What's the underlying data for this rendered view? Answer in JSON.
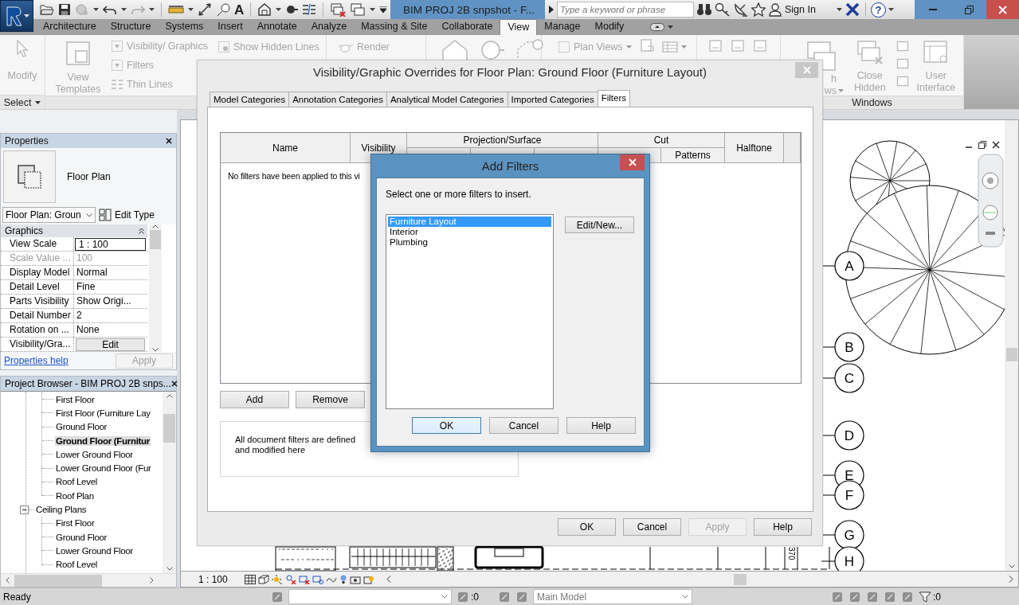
{
  "title_bar": {
    "text_tool_glyph": "A",
    "title": "BIM PROJ 2B snpshot - F...",
    "search": {
      "placeholder": "Type a keyword or phrase"
    },
    "sign_in": "Sign In",
    "help_glyph": "?"
  },
  "ribbon_tabs": [
    {
      "label": "Architecture",
      "selected": false
    },
    {
      "label": "Structure",
      "selected": false
    },
    {
      "label": "Systems",
      "selected": false
    },
    {
      "label": "Insert",
      "selected": false
    },
    {
      "label": "Annotate",
      "selected": false
    },
    {
      "label": "Analyze",
      "selected": false
    },
    {
      "label": "Massing & Site",
      "selected": false
    },
    {
      "label": "Collaborate",
      "selected": false
    },
    {
      "label": "View",
      "selected": true
    },
    {
      "label": "Manage",
      "selected": false
    },
    {
      "label": "Modify",
      "selected": false
    }
  ],
  "ribbon": {
    "modify": "Modify",
    "select_panel": "Select",
    "view_templates": "View Templates",
    "graphics_buttons": [
      "Visibility/ Graphics",
      "Filters",
      "Thin Lines"
    ],
    "show_hidden_lines": "Show Hidden Lines",
    "render": "Render",
    "plan_views": "Plan Views",
    "switch_windows_visible": "h ws",
    "close_hidden": "Close Hidden",
    "user_interface": "User Interface",
    "windows_panel": "Windows"
  },
  "properties": {
    "title": "Properties",
    "type_name": "Floor Plan",
    "type_selector": "Floor Plan: Groun",
    "edit_type": "Edit Type",
    "group": "Graphics",
    "rows": [
      {
        "name": "View Scale",
        "value": "1 : 100",
        "kind": "field",
        "disabled": false
      },
      {
        "name": "Scale Value ...",
        "value": "100",
        "kind": "text",
        "disabled": true
      },
      {
        "name": "Display Model",
        "value": "Normal",
        "kind": "text",
        "disabled": false
      },
      {
        "name": "Detail Level",
        "value": "Fine",
        "kind": "text",
        "disabled": false
      },
      {
        "name": "Parts Visibility",
        "value": "Show Origi...",
        "kind": "text",
        "disabled": false
      },
      {
        "name": "Detail Number",
        "value": "2",
        "kind": "text",
        "disabled": false
      },
      {
        "name": "Rotation on ...",
        "value": "None",
        "kind": "text",
        "disabled": false
      },
      {
        "name": "Visibility/Gra...",
        "value": "Edit",
        "kind": "button",
        "disabled": false
      }
    ],
    "help_link": "Properties help",
    "apply": {
      "label": "Apply",
      "disabled": true
    }
  },
  "project_browser": {
    "title": "Project Browser - BIM PROJ 2B snps...",
    "tree": [
      {
        "children": [
          {
            "label": "First Floor",
            "selected": false
          },
          {
            "label": "First Floor (Furniture Lay",
            "selected": false
          },
          {
            "label": "Ground  Floor",
            "selected": false
          },
          {
            "label": "Ground  Floor  (Furnitur",
            "selected": true
          },
          {
            "label": "Lower Ground Floor",
            "selected": false
          },
          {
            "label": "Lower Ground Floor (Fur",
            "selected": false
          },
          {
            "label": "Roof Level",
            "selected": false
          },
          {
            "label": "Roof Plan",
            "selected": false
          }
        ]
      },
      {
        "label": "Ceiling Plans",
        "selected": false,
        "expanded": true,
        "children": [
          {
            "label": "First Floor",
            "selected": false
          },
          {
            "label": "Ground  Floor",
            "selected": false
          },
          {
            "label": "Lower Ground Floor",
            "selected": false
          },
          {
            "label": "Roof Level",
            "selected": false
          }
        ]
      }
    ]
  },
  "canvas": {
    "grid_bubbles": [
      "A",
      "B",
      "C",
      "D",
      "E",
      "F",
      "G",
      "H"
    ],
    "dimension_text": "370"
  },
  "view_bar": {
    "scale": "1 : 100"
  },
  "status_bar": {
    "message": "Ready",
    "workset_count": ":0",
    "model": "Main Model",
    "filter_count": ":0"
  },
  "vg_dialog": {
    "title": "Visibility/Graphic Overrides for Floor Plan: Ground  Floor  (Furniture  Layout)",
    "tabs": [
      {
        "label": "Model Categories",
        "selected": false
      },
      {
        "label": "Annotation Categories",
        "selected": false
      },
      {
        "label": "Analytical Model Categories",
        "selected": false
      },
      {
        "label": "Imported Categories",
        "selected": false
      },
      {
        "label": "Filters",
        "selected": true
      }
    ],
    "columns": [
      {
        "label": "Name"
      },
      {
        "label": "Visibility"
      },
      {
        "label": "Projection/Surface"
      },
      {
        "label": "Cut",
        "subcolumn": "Patterns"
      },
      {
        "label": "Halftone"
      }
    ],
    "empty_message": "No filters have been applied to this vi",
    "add": "Add",
    "remove": "Remove",
    "note": "All document filters are defined and modified here",
    "buttons": [
      {
        "label": "OK",
        "disabled": false
      },
      {
        "label": "Cancel",
        "disabled": false
      },
      {
        "label": "Apply",
        "disabled": true
      },
      {
        "label": "Help",
        "disabled": false
      }
    ]
  },
  "add_filters": {
    "title": "Add Filters",
    "prompt": "Select one or more filters to insert.",
    "filters": [
      {
        "label": "Furniture Layout",
        "selected": true
      },
      {
        "label": "Interior",
        "selected": false
      },
      {
        "label": "Plumbing",
        "selected": false
      }
    ],
    "edit_new": "Edit/New...",
    "buttons": [
      {
        "label": "OK",
        "default": true
      },
      {
        "label": "Cancel",
        "default": false
      },
      {
        "label": "Help",
        "default": false
      }
    ]
  }
}
